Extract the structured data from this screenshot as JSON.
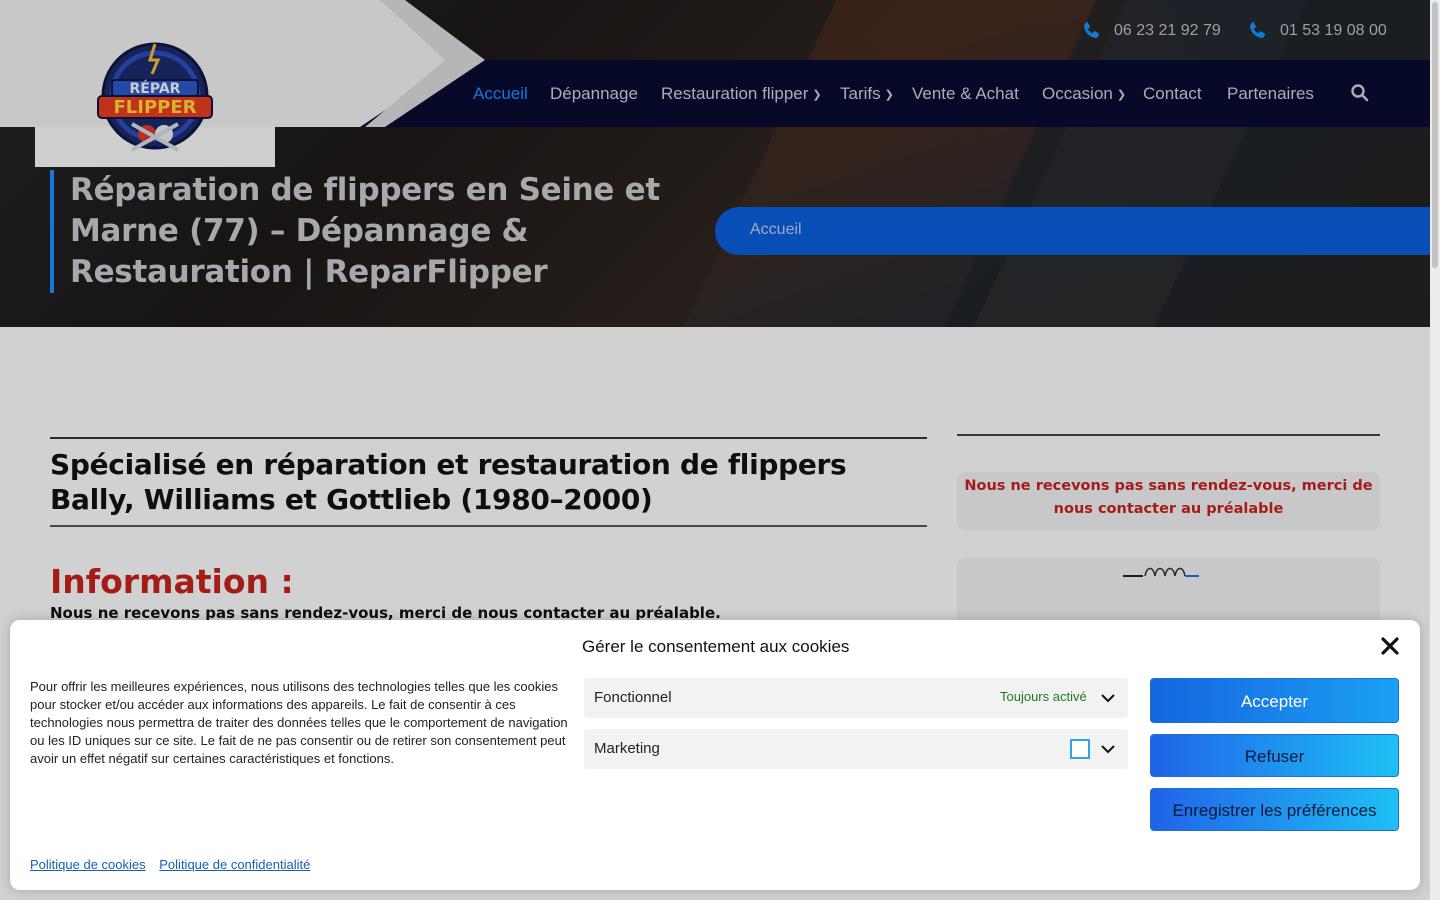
{
  "topbar": {
    "phone1": "06 23 21 92 79",
    "phone2": "01 53 19 08 00"
  },
  "logo": {
    "line1": "RÉPAR",
    "line2": "FLIPPER"
  },
  "nav": {
    "items": [
      {
        "label": "Accueil",
        "active": true
      },
      {
        "label": "Dépannage"
      },
      {
        "label": "Restauration flipper",
        "dropdown": true
      },
      {
        "label": "Tarifs",
        "dropdown": true
      },
      {
        "label": "Vente & Achat"
      },
      {
        "label": "Occasion",
        "dropdown": true
      },
      {
        "label": "Contact"
      },
      {
        "label": "Partenaires"
      }
    ],
    "search_icon": "search-icon"
  },
  "hero": {
    "title": "Réparation de flippers en Seine et Marne (77) – Dépannage & Restauration | ReparFlipper",
    "breadcrumb": "Accueil"
  },
  "main": {
    "heading": "Spécialisé en réparation et restauration de flippers Bally, Williams et Gottlieb (1980–2000)",
    "info_title": "Information :",
    "info_text": "Nous ne recevons pas sans rendez-vous, merci de nous contacter au préalable."
  },
  "sidebar": {
    "notice": "Nous ne recevons pas sans rendez-vous, merci de nous contacter au préalable"
  },
  "cookie": {
    "title": "Gérer le consentement aux cookies",
    "text": "Pour offrir les meilleures expériences, nous utilisons des technologies telles que les cookies pour stocker et/ou accéder aux informations des appareils. Le fait de consentir à ces technologies nous permettra de traiter des données telles que le comportement de navigation ou les ID uniques sur ce site. Le fait de ne pas consentir ou de retirer son consentement peut avoir un effet négatif sur certaines caractéristiques et fonctions.",
    "pref_functional": "Fonctionnel",
    "pref_functional_status": "Toujours activé",
    "pref_marketing": "Marketing",
    "accept": "Accepter",
    "refuse": "Refuser",
    "save": "Enregistrer les préférences",
    "link_cookies": "Politique de cookies",
    "link_privacy": "Politique de confidentialité"
  },
  "colors": {
    "accent": "#1c8bff",
    "nav_bg": "#080b2e",
    "alert_red": "#c0221c",
    "status_green": "#1f7a1f"
  }
}
